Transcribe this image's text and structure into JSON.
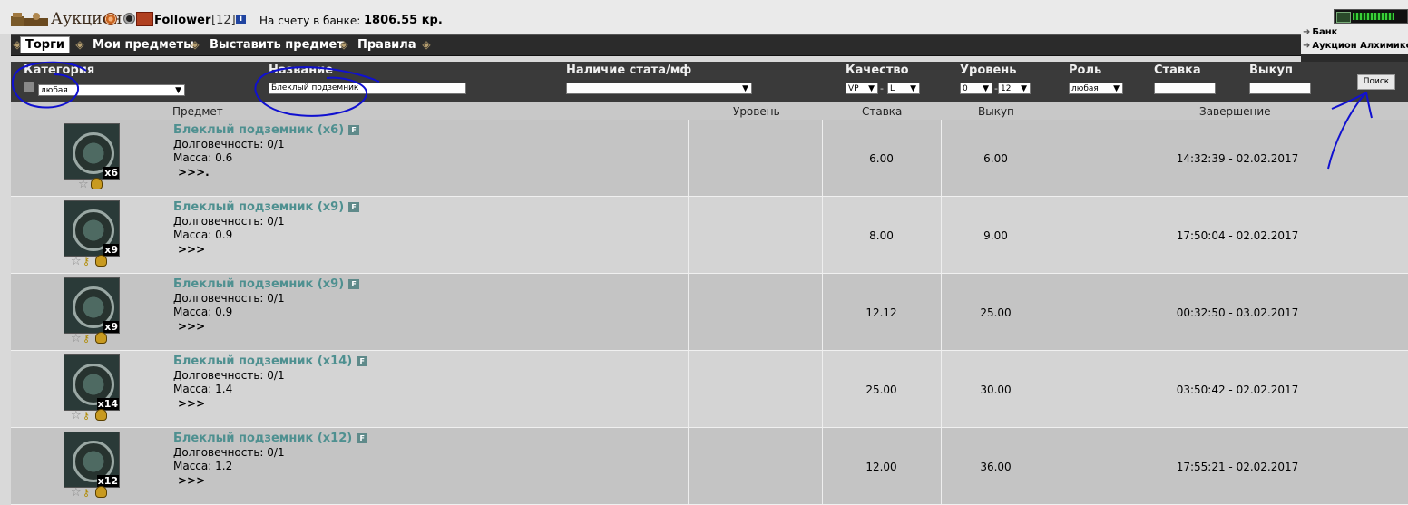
{
  "header": {
    "title": "Аукцион",
    "player_name": "Follower",
    "player_level": "[12]",
    "info_glyph": "i",
    "bank_label": "На счету в банке:",
    "bank_value": "1806.55 кр.",
    "gauge_fill_fraction": 0.8,
    "right_links": [
      "Банк",
      "Аукцион Алхимико"
    ]
  },
  "nav": {
    "items": [
      "Торги",
      "Мои предметы",
      "Выставить предмет",
      "Правила"
    ],
    "active_index": 0
  },
  "filters": {
    "category": {
      "label": "Категория",
      "value": "любая"
    },
    "name": {
      "label": "Название",
      "value": "Блеклый подземник"
    },
    "stat": {
      "label": "Наличие стата/мф",
      "value": ""
    },
    "quality": {
      "label": "Качество",
      "from": "VP",
      "to": "L"
    },
    "level": {
      "label": "Уровень",
      "from": "0",
      "to": "12"
    },
    "role": {
      "label": "Роль",
      "value": "любая"
    },
    "bid": {
      "label": "Ставка",
      "value": ""
    },
    "buyout": {
      "label": "Выкуп",
      "value": ""
    },
    "search_button": "Поиск"
  },
  "table": {
    "headers": [
      "Предмет",
      "Уровень",
      "Ставка",
      "Выкуп",
      "Завершение"
    ],
    "durability_label": "Долговечность:",
    "mass_label": "Масса:",
    "more_label": ">>>",
    "badge_label": "F",
    "rows": [
      {
        "name": "Блеклый подземник (x6)",
        "count": "x6",
        "durability": "0/1",
        "mass": "0.6",
        "more": ">>>.",
        "level": "",
        "bid": "6.00",
        "buyout": "6.00",
        "end": "14:32:39 - 02.02.2017",
        "icons": [
          "star-icon",
          "bag-icon"
        ]
      },
      {
        "name": "Блеклый подземник (x9)",
        "count": "x9",
        "durability": "0/1",
        "mass": "0.9",
        "more": ">>>",
        "level": "",
        "bid": "8.00",
        "buyout": "9.00",
        "end": "17:50:04 - 02.02.2017",
        "icons": [
          "star-icon",
          "key-icon",
          "bag-icon"
        ]
      },
      {
        "name": "Блеклый подземник (x9)",
        "count": "x9",
        "durability": "0/1",
        "mass": "0.9",
        "more": ">>>",
        "level": "",
        "bid": "12.12",
        "buyout": "25.00",
        "end": "00:32:50 - 03.02.2017",
        "icons": [
          "star-icon",
          "key-icon",
          "bag-icon"
        ]
      },
      {
        "name": "Блеклый подземник (x14)",
        "count": "x14",
        "durability": "0/1",
        "mass": "1.4",
        "more": ">>>",
        "level": "",
        "bid": "25.00",
        "buyout": "30.00",
        "end": "03:50:42 - 02.02.2017",
        "icons": [
          "star-icon",
          "key-icon",
          "bag-icon"
        ]
      },
      {
        "name": "Блеклый подземник (x12)",
        "count": "x12",
        "durability": "0/1",
        "mass": "1.2",
        "more": ">>>",
        "level": "",
        "bid": "12.00",
        "buyout": "36.00",
        "end": "17:55:21 - 02.02.2017",
        "icons": [
          "star-icon",
          "key-icon",
          "bag-icon"
        ]
      }
    ]
  },
  "colors": {
    "item_name": "#4e9090",
    "annotation": "#1010d0",
    "nav_bg": "#2b2b2b",
    "filter_bg": "#3a3a3a"
  }
}
